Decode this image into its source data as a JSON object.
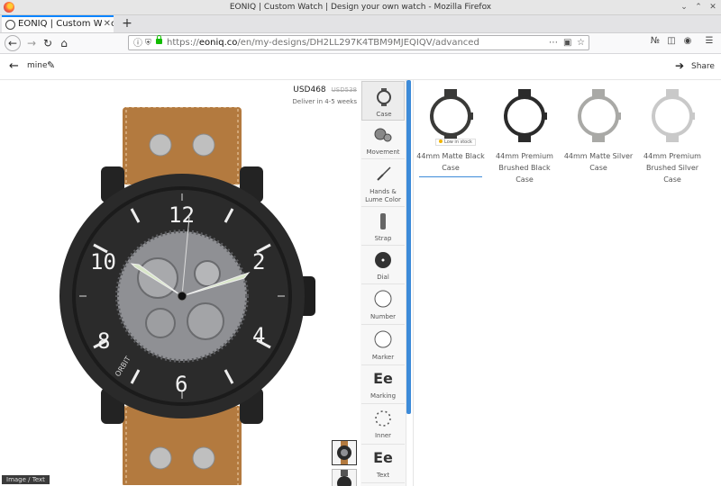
{
  "window": {
    "title": "EONIQ | Custom Watch | Design your own watch - Mozilla Firefox"
  },
  "tab": {
    "title": "EONIQ | Custom Watch"
  },
  "url": {
    "scheme": "https://",
    "domain": "eoniq.co",
    "path": "/en/my-designs/DH2LL297K4TBM9MJEQIQV/advanced"
  },
  "header": {
    "design_name": "mine",
    "share_label": "Share"
  },
  "preview": {
    "price": "USD468",
    "old_price": "USD538",
    "delivery": "Deliver in 4-5 weeks",
    "image_tag": "Image / Text",
    "dial_numerals": [
      "12",
      "2",
      "4",
      "6",
      "8",
      "10"
    ],
    "dial_brand": "ORBIT"
  },
  "menu": [
    {
      "label": "Case",
      "icon": "watch-case-icon",
      "active": true
    },
    {
      "label": "Movement",
      "icon": "movement-gears-icon"
    },
    {
      "label": "Hands & Lume Color",
      "icon": "watch-hands-icon"
    },
    {
      "label": "Strap",
      "icon": "strap-icon"
    },
    {
      "label": "Dial",
      "icon": "dial-icon"
    },
    {
      "label": "Number",
      "icon": "number-circle-icon"
    },
    {
      "label": "Marker",
      "icon": "marker-circle-icon"
    },
    {
      "label": "Marking",
      "icon": "marking-ee-icon",
      "glyph": "Ee"
    },
    {
      "label": "Inner",
      "icon": "inner-ring-icon"
    },
    {
      "label": "Text",
      "icon": "text-ee-icon",
      "glyph": "Ee"
    }
  ],
  "options": [
    {
      "label": "44mm Matte Black Case",
      "badge": "Low in stock",
      "selected": true,
      "color": "#3a3a38"
    },
    {
      "label": "44mm Premium Brushed Black Case",
      "color": "#2b2b2b"
    },
    {
      "label": "44mm Matte Silver Case",
      "color": "#a9a9a6"
    },
    {
      "label": "44mm Premium Brushed Silver Case",
      "color": "#c9c9c9"
    }
  ],
  "colors": {
    "accent": "#3d8bd9",
    "strap": "#b37a3f",
    "case": "#2a2a2a",
    "lume": "#d8e6c8"
  }
}
